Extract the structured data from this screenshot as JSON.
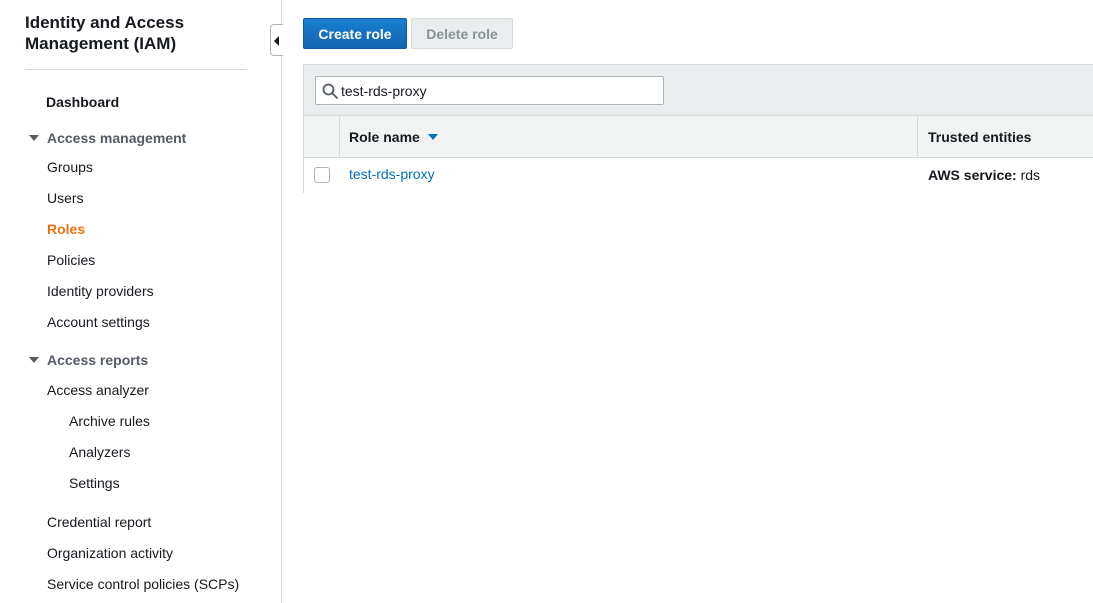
{
  "sidebar": {
    "title": "Identity and Access Management (IAM)",
    "dashboard": "Dashboard",
    "access_management": {
      "label": "Access management",
      "items": [
        "Groups",
        "Users",
        "Roles",
        "Policies",
        "Identity providers",
        "Account settings"
      ],
      "active": "Roles"
    },
    "access_reports": {
      "label": "Access reports",
      "access_analyzer": "Access analyzer",
      "analyzer_items": [
        "Archive rules",
        "Analyzers",
        "Settings"
      ],
      "items": [
        "Credential report",
        "Organization activity",
        "Service control policies (SCPs)"
      ]
    }
  },
  "toolbar": {
    "create_label": "Create role",
    "delete_label": "Delete role"
  },
  "search": {
    "value": "test-rds-proxy",
    "icon": "search-icon"
  },
  "table": {
    "columns": [
      "Role name",
      "Trusted entities"
    ],
    "sort_icon": "sort-descending-icon",
    "rows": [
      {
        "role_name": "test-rds-proxy",
        "trusted_prefix": "AWS service:",
        "trusted_value": "rds"
      }
    ]
  },
  "colors": {
    "accent": "#0073bb",
    "active": "#ec7211",
    "primary_button": "#1b6ac9"
  }
}
